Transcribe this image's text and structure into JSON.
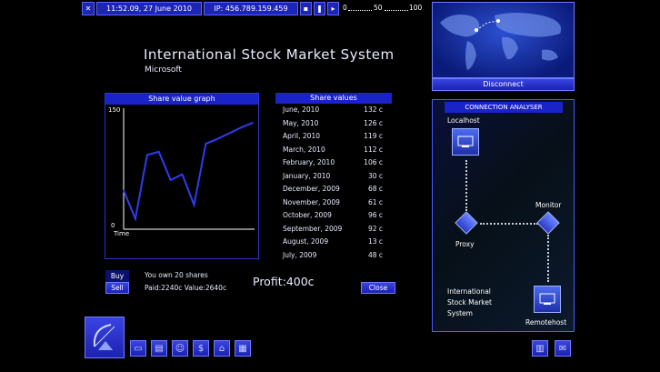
{
  "topbar": {
    "datetime": "11:52.09, 27 June 2010",
    "ip": "IP: 456.789.159.459",
    "speed_scale": {
      "min": "0",
      "mid": "50",
      "max": "100"
    }
  },
  "main": {
    "title": "International Stock Market System",
    "company": "Microsoft"
  },
  "graph": {
    "header": "Share value graph",
    "y_top": "150",
    "y_bottom": "0",
    "x_label": "Time"
  },
  "share_values": {
    "header": "Share values",
    "rows": [
      {
        "date": "June, 2010",
        "value": "132 c"
      },
      {
        "date": "May, 2010",
        "value": "126 c"
      },
      {
        "date": "April, 2010",
        "value": "119 c"
      },
      {
        "date": "March, 2010",
        "value": "112 c"
      },
      {
        "date": "February, 2010",
        "value": "106 c"
      },
      {
        "date": "January, 2010",
        "value": "30 c"
      },
      {
        "date": "December, 2009",
        "value": "68 c"
      },
      {
        "date": "November, 2009",
        "value": "61 c"
      },
      {
        "date": "October, 2009",
        "value": "96 c"
      },
      {
        "date": "September, 2009",
        "value": "92 c"
      },
      {
        "date": "August, 2009",
        "value": "13 c"
      },
      {
        "date": "July, 2009",
        "value": "48 c"
      }
    ]
  },
  "trade": {
    "buy_label": "Buy",
    "sell_label": "Sell",
    "shares_text": "You own 20 shares",
    "paid_text": "Paid:2240c Value:2640c",
    "profit_text": "Profit:400c",
    "close_label": "Close"
  },
  "map": {
    "disconnect_label": "Disconnect"
  },
  "connection": {
    "header": "CONNECTION ANALYSER",
    "localhost": "Localhost",
    "monitor": "Monitor",
    "proxy": "Proxy",
    "remotehost": "Remotehost",
    "target_line1": "International",
    "target_line2": "Stock Market",
    "target_line3": "System"
  },
  "chart_data": {
    "type": "line",
    "ylim": [
      0,
      150
    ],
    "x": [
      "July, 2009",
      "August, 2009",
      "September, 2009",
      "October, 2009",
      "November, 2009",
      "December, 2009",
      "January, 2010",
      "February, 2010",
      "March, 2010",
      "April, 2010",
      "May, 2010",
      "June, 2010"
    ],
    "values": [
      48,
      13,
      92,
      96,
      61,
      68,
      30,
      106,
      112,
      119,
      126,
      132
    ],
    "color": "#2f3cf0"
  },
  "icons": {
    "close": "close-icon",
    "satellite": "satellite-dish-icon",
    "toolbar": [
      "computer-icon",
      "software-icon",
      "people-icon",
      "money-icon",
      "home-icon",
      "hardware-icon"
    ],
    "bottom_right": [
      "documents-icon",
      "email-icon"
    ]
  }
}
